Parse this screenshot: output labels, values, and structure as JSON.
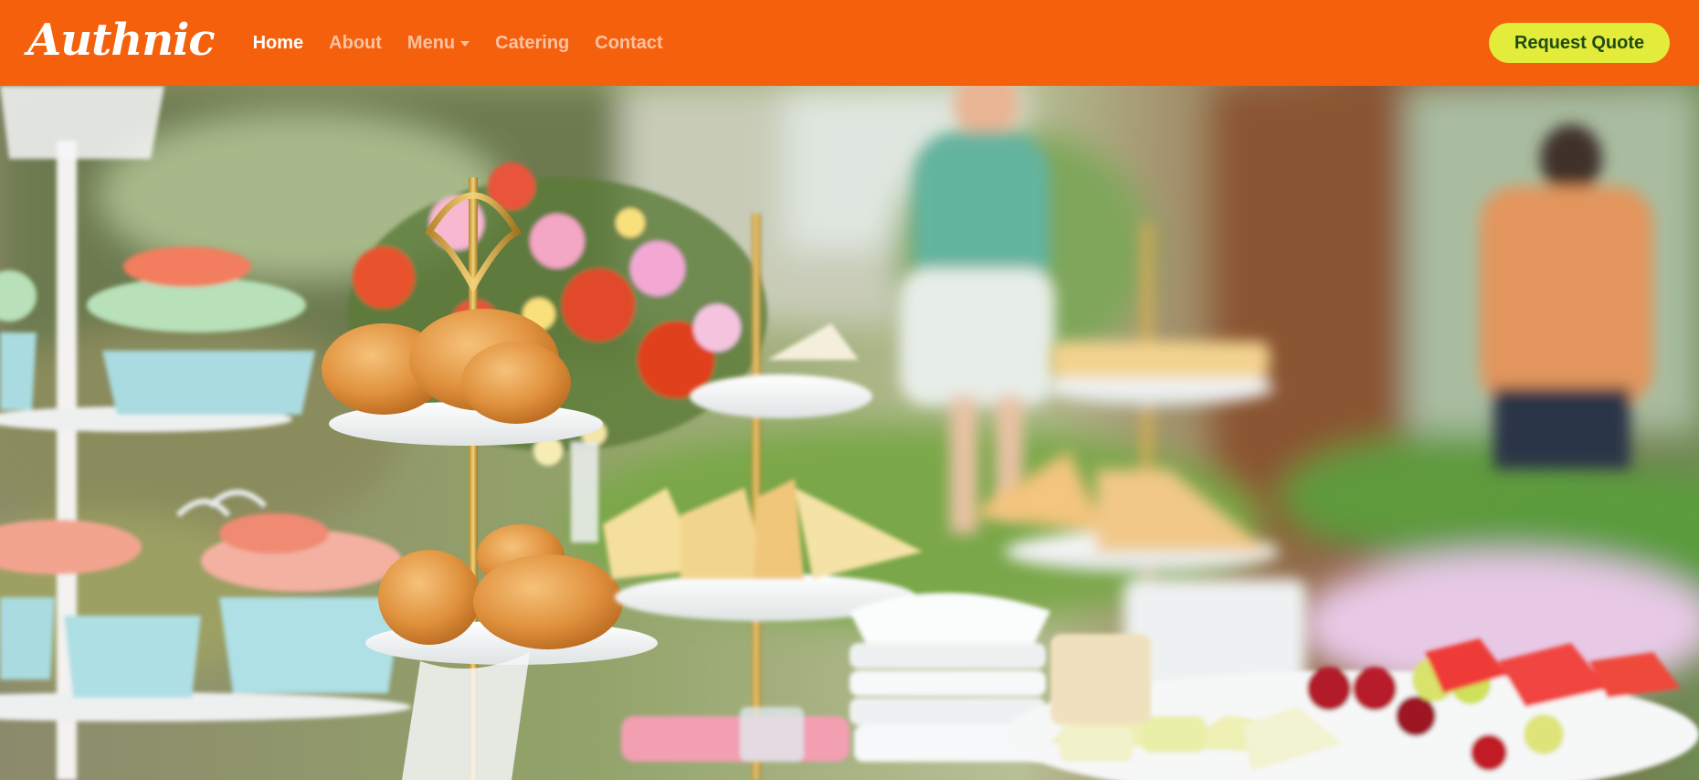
{
  "navbar": {
    "brand": "Authnic",
    "links": [
      {
        "label": "Home",
        "active": true
      },
      {
        "label": "About",
        "active": false
      },
      {
        "label": "Menu",
        "active": false,
        "dropdown": true
      },
      {
        "label": "Catering",
        "active": false
      },
      {
        "label": "Contact",
        "active": false
      }
    ],
    "cta_label": "Request Quote"
  },
  "colors": {
    "navbar_bg": "#f4600c",
    "cta_bg": "#e3ec3a",
    "cta_text": "#1f4b14"
  },
  "hero": {
    "image_subject": "outdoor catering dessert table with cream puffs, cupcakes, sandwiches and fruit"
  }
}
